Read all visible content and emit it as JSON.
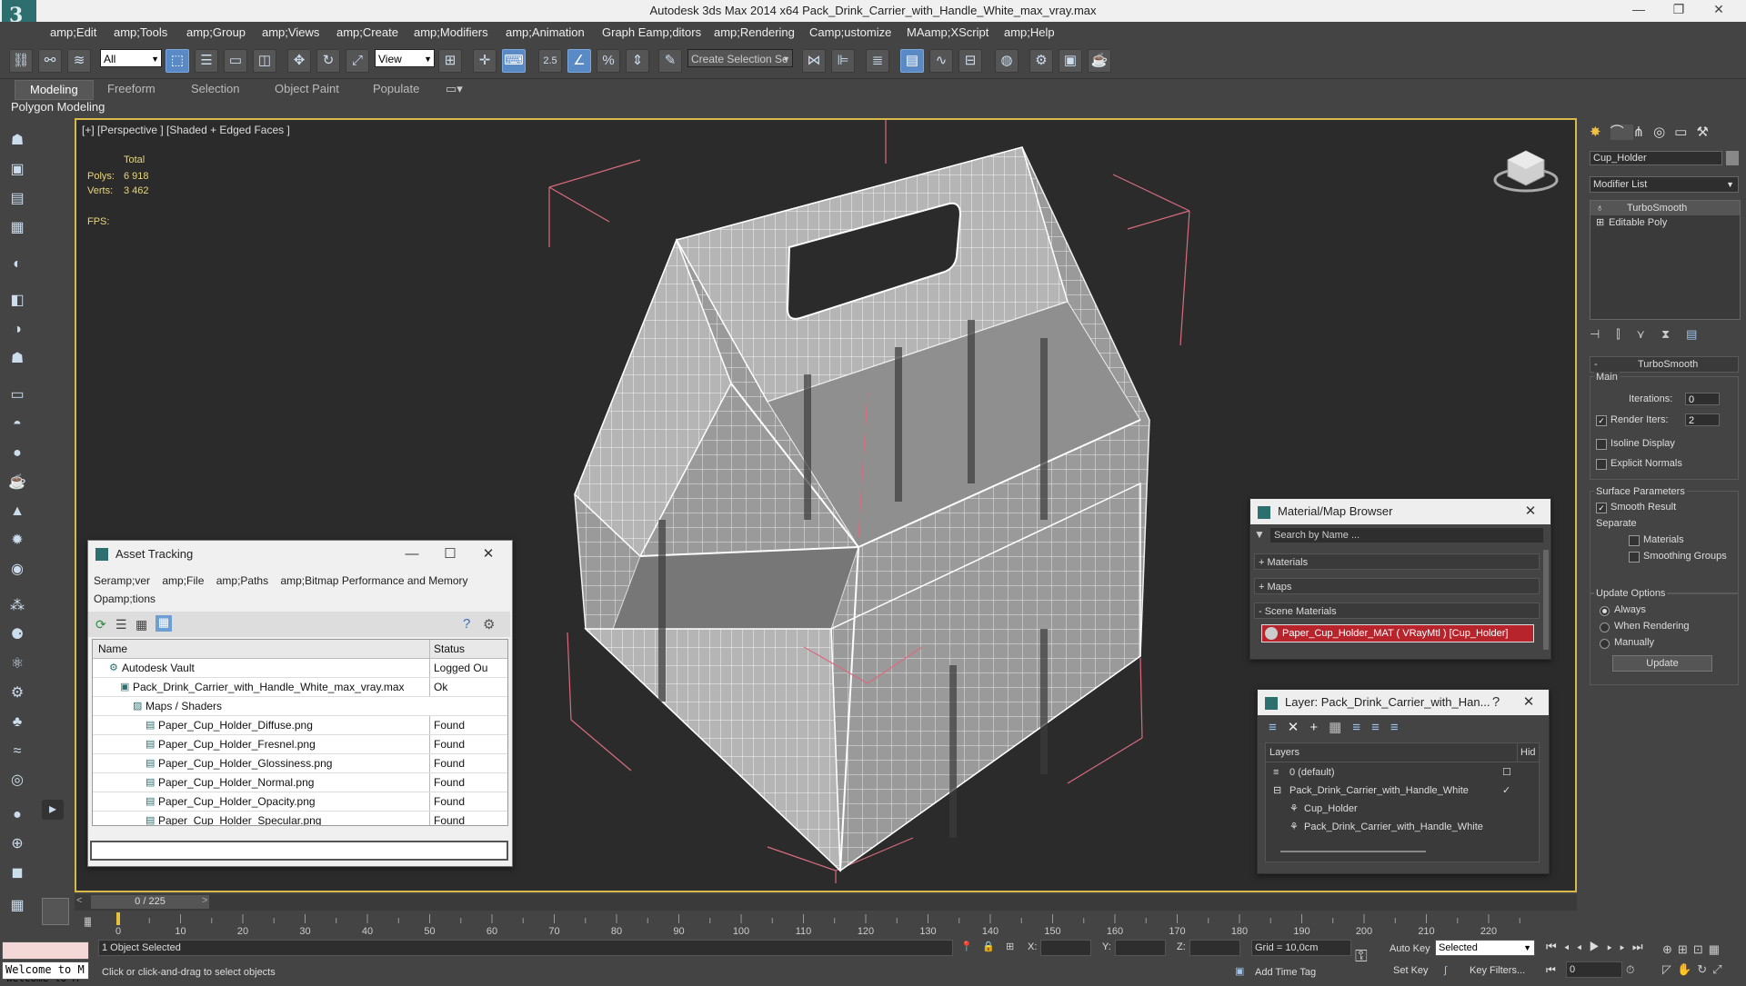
{
  "window": {
    "title": "Autodesk 3ds Max  2014 x64      Pack_Drink_Carrier_with_Handle_White_max_vray.max",
    "min": "—",
    "max": "❐",
    "close": "✕"
  },
  "menu": [
    "amp;Edit",
    "amp;Tools",
    "amp;Group",
    "amp;Views",
    "amp;Create",
    "amp;Modifiers",
    "amp;Animation",
    "Graph Eamp;ditors",
    "amp;Rendering",
    "Camp;ustomize",
    "MAamp;XScript",
    "amp;Help"
  ],
  "toolbar": {
    "selection_filter": "All",
    "ref_coord": "View",
    "snap_label": "2.5",
    "create_selection_set": "Create Selection Se"
  },
  "ribbon": {
    "tabs": [
      "Modeling",
      "Freeform",
      "Selection",
      "Object Paint",
      "Populate"
    ],
    "active": "Modeling",
    "sub_label": "Polygon Modeling"
  },
  "viewport": {
    "label": "[+] [Perspective ] [Shaded + Edged Faces ]",
    "stats_header": "Total",
    "polys_label": "Polys:",
    "polys_value": "6 918",
    "verts_label": "Verts:",
    "verts_value": "3 462",
    "fps_label": "FPS:"
  },
  "asset_tracking": {
    "title": "Asset Tracking",
    "menu": [
      "Seramp;ver",
      "amp;File",
      "amp;Paths",
      "amp;Bitmap Performance and Memory",
      "Opamp;tions"
    ],
    "columns": [
      "Name",
      "Status"
    ],
    "rows": [
      {
        "name": "Autodesk Vault",
        "status": "Logged Ou"
      },
      {
        "name": "Pack_Drink_Carrier_with_Handle_White_max_vray.max",
        "status": "Ok"
      },
      {
        "name": "Maps / Shaders",
        "status": ""
      },
      {
        "name": "Paper_Cup_Holder_Diffuse.png",
        "status": "Found"
      },
      {
        "name": "Paper_Cup_Holder_Fresnel.png",
        "status": "Found"
      },
      {
        "name": "Paper_Cup_Holder_Glossiness.png",
        "status": "Found"
      },
      {
        "name": "Paper_Cup_Holder_Normal.png",
        "status": "Found"
      },
      {
        "name": "Paper_Cup_Holder_Opacity.png",
        "status": "Found"
      },
      {
        "name": "Paper_Cup_Holder_Specular.png",
        "status": "Found"
      }
    ]
  },
  "material_browser": {
    "title": "Material/Map Browser",
    "search_placeholder": "Search by Name ...",
    "sections": [
      "+ Materials",
      "+ Maps",
      "- Scene Materials"
    ],
    "scene_material": "Paper_Cup_Holder_MAT ( VRayMtl ) [Cup_Holder]"
  },
  "layer_dialog": {
    "title": "Layer: Pack_Drink_Carrier_with_Han...",
    "help": "?",
    "col_layers": "Layers",
    "col_hide": "Hid",
    "rows": [
      "0 (default)",
      "Pack_Drink_Carrier_with_Handle_White",
      "Cup_Holder",
      "Pack_Drink_Carrier_with_Handle_White"
    ]
  },
  "command_panel": {
    "object_name": "Cup_Holder",
    "modifier_list": "Modifier List",
    "stack": [
      "TurboSmooth",
      "Editable Poly"
    ],
    "rollout_title": "TurboSmooth",
    "main_label": "Main",
    "iterations_label": "Iterations:",
    "iterations_value": "0",
    "render_iters_label": "Render Iters:",
    "render_iters_value": "2",
    "isoline": "Isoline Display",
    "explicit_normals": "Explicit Normals",
    "surface_params": "Surface Parameters",
    "smooth_result": "Smooth Result",
    "separate": "Separate",
    "materials": "Materials",
    "smoothing_groups": "Smoothing Groups",
    "update_options": "Update Options",
    "always": "Always",
    "when_rendering": "When Rendering",
    "manually": "Manually",
    "update_button": "Update"
  },
  "timeline": {
    "frame_counter": "0 / 225",
    "ticks": [
      "0",
      "10",
      "20",
      "30",
      "40",
      "50",
      "60",
      "70",
      "80",
      "90",
      "100",
      "110",
      "120",
      "130",
      "140",
      "150",
      "160",
      "170",
      "180",
      "190",
      "200",
      "210",
      "220"
    ]
  },
  "status": {
    "welcome": "Welcome to M",
    "selected": "1 Object Selected",
    "prompt": "Click or click-and-drag to select objects",
    "x_label": "X:",
    "y_label": "Y:",
    "z_label": "Z:",
    "grid": "Grid = 10,0cm",
    "add_time_tag": "Add Time Tag",
    "auto_key": "Auto Key",
    "set_key": "Set Key",
    "selected_dropdown": "Selected",
    "key_filters": "Key Filters...",
    "frame_value": "0"
  }
}
